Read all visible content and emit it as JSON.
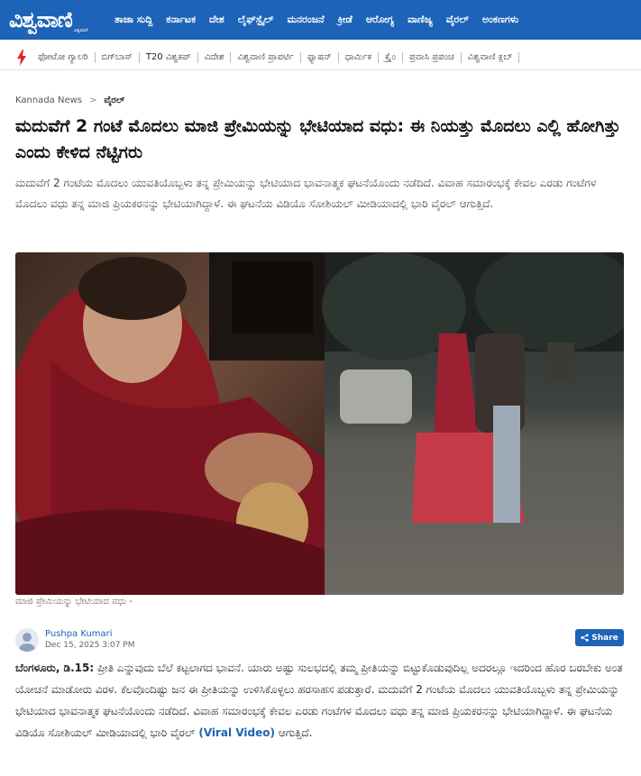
{
  "header": {
    "logo_text": "ವಿಶ್ವವಾಣಿ",
    "logo_tagline": "ವಿಶ್ವವಾಣಿ",
    "nav_items": [
      "ತಾಜಾ ಸುದ್ದಿ",
      "ಕರ್ನಾಟಕ",
      "ದೇಶ",
      "ಲೈಫ್‌ಸ್ಟೈಲ್",
      "ಮನರಂಜನೆ",
      "ಕ್ರೀಡೆ",
      "ಆರೋಗ್ಯ",
      "ವಾಣಿಜ್ಯ",
      "ವೈರಲ್",
      "ಅಂಕಣಗಳು"
    ],
    "brand_color": "#1d63b8"
  },
  "subnav": {
    "flash_icon": "lightning-icon",
    "items": [
      "ಫೋಟೋ ಗ್ಯಾಲರಿ",
      "ಬಿಗ್‌ಬಾಸ್",
      "T20 ವಿಶ್ವಕಪ್",
      "ವಿದೇಶ",
      "ವಿಶ್ವವಾಣಿ ಪ್ರಾಪರ್ಟಿ",
      "ಫ್ಯಾಷನ್",
      "ಧಾರ್ಮಿಕ",
      "ಕ್ರೈಂ",
      "ಪ್ರವಾಸಿ ಪ್ರಪಂಚ",
      "ವಿಶ್ವವಾಣಿ ಕ್ಲಬ್"
    ]
  },
  "breadcrumb": {
    "home": "Kannada News",
    "separator": ">",
    "current": "ವೈರಲ್"
  },
  "article": {
    "title": "ಮದುವೆಗೆ 2 ಗಂಟೆ ಮೊದಲು ಮಾಜಿ ಪ್ರೇಮಿಯನ್ನು ಭೇಟಿಯಾದ ವಧು: ಈ ನಿಯತ್ತು ಮೊದಲು ಎಲ್ಲಿ ಹೋಗಿತ್ತು ಎಂದು ಕೇಳಿದ ನೆಟ್ಟಿಗರು",
    "summary": "ಮದುವೆಗೆ 2 ಗಂಟೆಯ ಮೊದಲು ಯುವತಿಯೊಬ್ಬಳು ತನ್ನ ಪ್ರೇಮಿಯನ್ನು ಭೇಟಿಯಾದ ಭಾವನಾತ್ಮಕ ಘಟನೆಯೊಂದು ನಡೆದಿದೆ. ವಿವಾಹ ಸಮಾರಂಭಕ್ಕೆ ಕೇವಲ ಎರಡು ಗಂಟೆಗಳ ಮೊದಲು ವಧು ತನ್ನ ಮಾಜಿ ಪ್ರಿಯಕರನನ್ನು ಭೇಟಿಯಾಗಿದ್ದಾಳೆ. ಈ ಘಟನೆಯ ವಿಡಿಯೊ ಸೋಶಿಯಲ್ ಮೀಡಿಯಾದಲ್ಲಿ ಭಾರಿ ವೈರಲ್ ಆಗುತ್ತಿದೆ.",
    "image_caption": "ಮಾಜಿ ಪ್ರೇಮಿಯನ್ನು ಭೇಟಿಯಾದ ವಧು -",
    "author_name": "Pushpa Kumari",
    "date": "Dec 15, 2025 3:07 PM",
    "share_label": "Share",
    "dateline": "ಬೆಂಗಳೂರು, ಡಿ.15:",
    "body_part1": " ಪ್ರೀತಿ ಎನ್ನುವುದು ಬೆಲೆ ಕಟ್ಟಲಾಗದ ಭಾವನೆ. ಯಾರು ಅಷ್ಟು ಸುಲಭದಲ್ಲಿ ತಮ್ಮ ಪ್ರೀತಿಯನ್ನು ಬಿಟ್ಟುಕೊಡುವುದಿಲ್ಲ ಅದರಲ್ಲೂ ಇದರಿಂದ ಹೊರ ಬರಬೇಕು ಅಂತ ಯೋಚನೆ ಮಾಡೋರು ವಿರಳ. ಕೆಲವೊಂದಿಷ್ಟು ಜನ ಈ ಪ್ರೀತಿಯನ್ನು ಉಳಿಸಿಕೊಳ್ಳಲು ಹರಸಾಹಸ ಪಡುತ್ತಾರೆ. ಮದುವೆಗೆ 2 ಗಂಟೆಯ ಮೊದಲು ಯುವತಿಯೊಬ್ಬಳು ತನ್ನ ಪ್ರೇಮಿಯನ್ನು ಭೇಟಿಯಾದ ಭಾವನಾತ್ಮಕ ಘಟನೆಯೊಂದು ನಡೆದಿದೆ. ವಿವಾಹ ಸಮಾರಂಭಕ್ಕೆ ಕೇವಲ ಎರಡು ಗಂಟೆಗಳ ಮೊದಲು ವಧು ತನ್ನ ಮಾಜಿ ಪ್ರಿಯಕರನನ್ನು ಭೇಟಿಯಾಗಿದ್ದಾಳೆ. ಈ ಘಟನೆಯ ವಿಡಿಯೊ ಸೋಶಿಯಲ್ ಮೀಡಿಯಾದಲ್ಲಿ ಭಾರಿ ವೈರಲ್ ",
    "body_link": "(Viral Video)",
    "body_part2": " ಆಗುತ್ತಿದೆ."
  }
}
